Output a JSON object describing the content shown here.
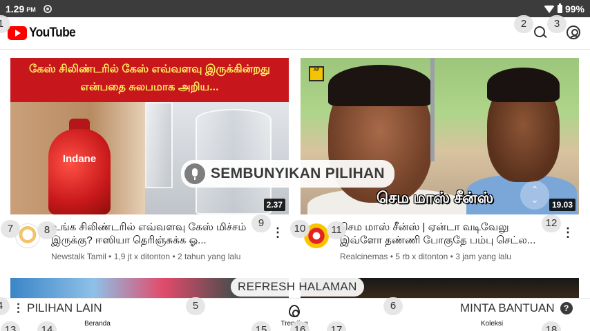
{
  "status_bar": {
    "time": "1.29",
    "ampm": "PM",
    "battery": "99%"
  },
  "app_bar": {
    "logo_text": "YouTube"
  },
  "overlay": {
    "hide_options": "SEMBUNYIKAN PILIHAN",
    "refresh": "REFRESH HALAMAN",
    "other_options": "PILIHAN LAIN",
    "help": "MINTA BANTUAN",
    "help_icon": "?"
  },
  "videos": [
    {
      "thumbnail_banner": "கேஸ் சிலிண்டரில் கேஸ் எவ்வளவு இருக்கின்றது என்பதை சுலபமாக அறிய...",
      "thumbnail_brand": "Indane",
      "duration": "2.37",
      "title": "உங்க சிலிண்டரில் எவ்வளவு கேஸ் மிச்சம் இருக்கு? ஈஸியா தெரிஞ்சுக்க ஓ...",
      "channel": "Newstalk Tamil",
      "views": "1,9 jt x ditonton",
      "age": "2 tahun yang lalu"
    },
    {
      "thumbnail_caption": "செம மாஸ் சீன்ஸ்",
      "thumbnail_logo": "AP",
      "duration": "19.03",
      "title": "செம மாஸ் சீன்ஸ் | ஏன்டா வடிவேலு இவ்ளோ தண்ணி போகுதே பம்பு செட்ல...",
      "channel": "Realcinemas",
      "views": "5 rb x ditonton",
      "age": "3 jam yang lalu"
    }
  ],
  "bottom_nav": {
    "home": "Beranda",
    "trending": "Trending",
    "library": "Koleksi"
  },
  "badges": [
    "1",
    "2",
    "3",
    "4",
    "5",
    "6",
    "7",
    "8",
    "9",
    "10",
    "11",
    "12",
    "13",
    "14",
    "15",
    "16",
    "17",
    "18"
  ],
  "colors": {
    "brand_red": "#ff0000",
    "status_bar": "#3c3c3c"
  }
}
